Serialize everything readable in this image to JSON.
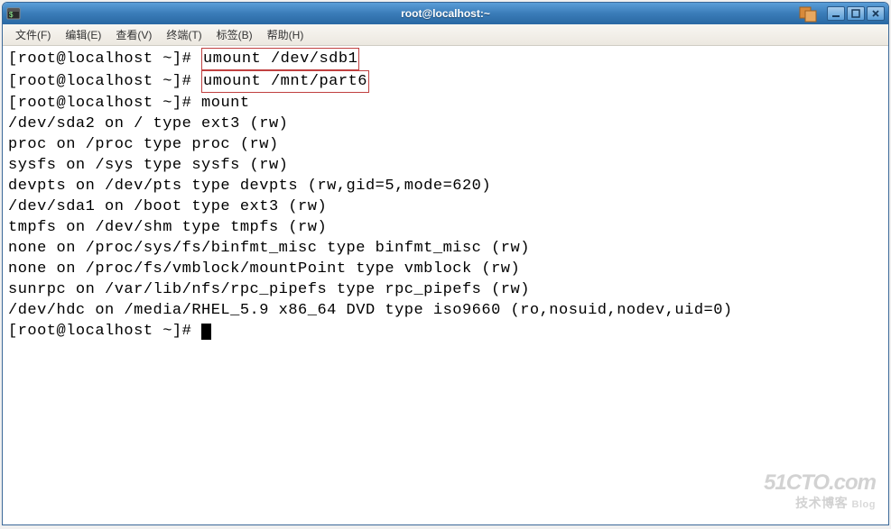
{
  "window": {
    "title": "root@localhost:~"
  },
  "menu": {
    "file": "文件(F)",
    "edit": "编辑(E)",
    "view": "查看(V)",
    "terminal": "终端(T)",
    "tabs": "标签(B)",
    "help": "帮助(H)"
  },
  "terminal": {
    "prompt": "[root@localhost ~]# ",
    "cmd1": "umount /dev/sdb1",
    "cmd2": "umount /mnt/part6",
    "cmd3": "mount",
    "out1": "/dev/sda2 on / type ext3 (rw)",
    "out2": "proc on /proc type proc (rw)",
    "out3": "sysfs on /sys type sysfs (rw)",
    "out4": "devpts on /dev/pts type devpts (rw,gid=5,mode=620)",
    "out5": "/dev/sda1 on /boot type ext3 (rw)",
    "out6": "tmpfs on /dev/shm type tmpfs (rw)",
    "out7": "none on /proc/sys/fs/binfmt_misc type binfmt_misc (rw)",
    "out8": "none on /proc/fs/vmblock/mountPoint type vmblock (rw)",
    "out9": "sunrpc on /var/lib/nfs/rpc_pipefs type rpc_pipefs (rw)",
    "out10": "/dev/hdc on /media/RHEL_5.9 x86_64 DVD type iso9660 (ro,nosuid,nodev,uid=0)"
  },
  "watermark": {
    "top": "51CTO.com",
    "bottom": "技术博客",
    "blog": "Blog"
  }
}
